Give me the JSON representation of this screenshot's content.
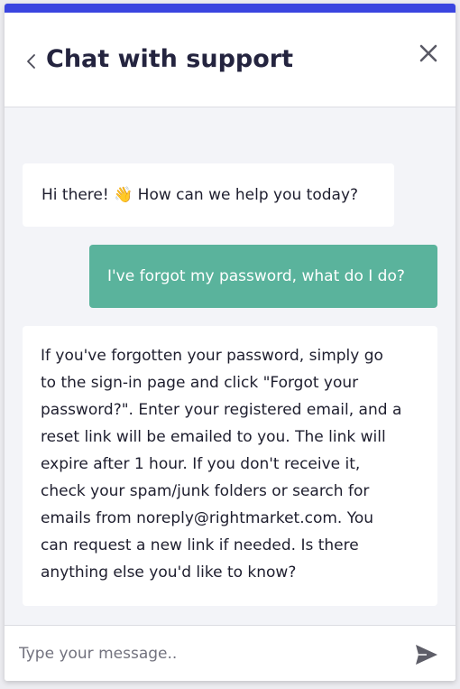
{
  "colors": {
    "accent_bar": "#3a45e0",
    "user_bubble": "#5ab39c",
    "agent_bubble": "#ffffff",
    "title_text": "#24243f"
  },
  "header": {
    "title": "Chat with support",
    "back_icon": "chevron-left-icon",
    "close_icon": "close-icon"
  },
  "messages": [
    {
      "sender": "agent",
      "text": "Hi there! 👋 How can we help you today?"
    },
    {
      "sender": "user",
      "text": "I've forgot my password, what do I do?"
    },
    {
      "sender": "agent",
      "text": "If you've forgotten your password, simply go\nto the sign-in page and click \"Forgot your\npassword?\". Enter your registered email, and a\nreset link will be emailed to you. The link will\nexpire after 1 hour. If you don't receive it,\ncheck your spam/junk folders or search for\nemails from noreply@rightmarket.com. You\ncan request a new link if needed. Is there\nanything else you'd like to know?"
    }
  ],
  "composer": {
    "placeholder": "Type your message..",
    "value": "",
    "send_icon": "send-icon"
  }
}
